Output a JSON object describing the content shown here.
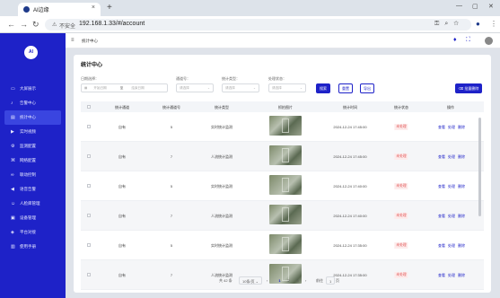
{
  "browser": {
    "tab_title": "AI边缘",
    "url_warning": "不安全",
    "url": "192.168.1.33/#/account"
  },
  "sidebar": {
    "logo_text": "AI",
    "items": [
      {
        "label": "大屏展示",
        "icon": "monitor-icon"
      },
      {
        "label": "告警中心",
        "icon": "bell-icon"
      },
      {
        "label": "统计中心",
        "icon": "chart-icon",
        "active": true
      },
      {
        "label": "实时视频",
        "icon": "video-icon"
      },
      {
        "label": "监测配置",
        "icon": "settings-icon"
      },
      {
        "label": "网络配置",
        "icon": "network-icon"
      },
      {
        "label": "联动控制",
        "icon": "link-icon"
      },
      {
        "label": "语音告警",
        "icon": "speaker-icon"
      },
      {
        "label": "人脸库管理",
        "icon": "face-icon"
      },
      {
        "label": "设备管理",
        "icon": "device-icon"
      },
      {
        "label": "平台对接",
        "icon": "platform-icon"
      },
      {
        "label": "使用手册",
        "icon": "book-icon"
      }
    ]
  },
  "topbar": {
    "breadcrumb": "统计中心"
  },
  "page": {
    "title": "统计中心",
    "filters": {
      "date_label": "日期选择：",
      "date_start_placeholder": "开始日期",
      "date_sep": "至",
      "date_end_placeholder": "结束日期",
      "channel_label": "通道号：",
      "channel_placeholder": "请选择",
      "type_label": "统计类型：",
      "type_placeholder": "请选择",
      "status_label": "处理状态：",
      "status_placeholder": "请选择"
    },
    "buttons": {
      "search": "搜索",
      "reset": "重置",
      "export": "导出",
      "batch_delete": "批量删除"
    }
  },
  "table": {
    "columns": [
      "统计通道",
      "统计通道号",
      "统计类型",
      "抓拍图片",
      "统计时间",
      "统计状态",
      "操作"
    ],
    "rows": [
      {
        "channel": "自有",
        "channel_no": "5",
        "type": "实时统计监测",
        "time": "2024-12-24 17:45:00",
        "status": "未处理"
      },
      {
        "channel": "自有",
        "channel_no": "7",
        "type": "人流统计监测",
        "time": "2024-12-24 17:45:00",
        "status": "未处理"
      },
      {
        "channel": "自有",
        "channel_no": "5",
        "type": "实时统计监测",
        "time": "2024-12-24 17:40:00",
        "status": "未处理"
      },
      {
        "channel": "自有",
        "channel_no": "7",
        "type": "人流统计监测",
        "time": "2024-12-24 17:40:00",
        "status": "未处理"
      },
      {
        "channel": "自有",
        "channel_no": "5",
        "type": "实时统计监测",
        "time": "2024-12-24 17:35:00",
        "status": "未处理"
      },
      {
        "channel": "自有",
        "channel_no": "7",
        "type": "人流统计监测",
        "time": "2024-12-24 17:35:00",
        "status": "未处理"
      }
    ],
    "ops": [
      "查看",
      "处理",
      "删除"
    ]
  },
  "pager": {
    "total": "共 42 条",
    "page_size": "10条/页",
    "pages": [
      "1",
      "2",
      "3"
    ],
    "current": "1",
    "goto_label": "前往",
    "goto_value": "1",
    "goto_suffix": "页"
  },
  "colors": {
    "primary": "#1e22c8",
    "sidebar": "#1e22c8",
    "status_red": "#e05050"
  }
}
